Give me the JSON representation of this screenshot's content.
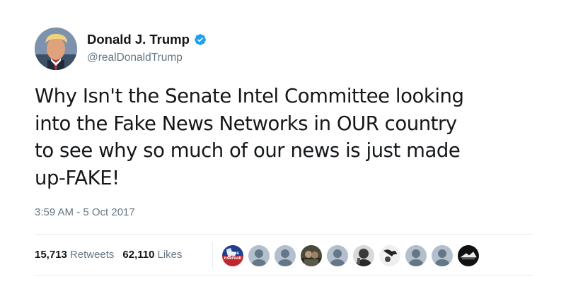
{
  "author": {
    "display_name": "Donald J. Trump",
    "screen_name": "@realDonaldTrump",
    "verified": true,
    "verified_icon": "verified-badge-icon",
    "avatar_icon": "profile-photo"
  },
  "tweet": {
    "text": "Why Isn't the Senate Intel Committee looking\ninto the Fake News Networks in OUR country\nto see why so much of our news is just made\nup-FAKE!",
    "timestamp": "3:59 AM - 5 Oct 2017"
  },
  "stats": {
    "retweets": {
      "count": "15,713",
      "label": "Retweets"
    },
    "likes": {
      "count": "62,110",
      "label": "Likes"
    }
  },
  "likers": [
    {
      "kind": "logo",
      "text_line1": "Texas",
      "text_line2": "nservati"
    },
    {
      "kind": "default-egg"
    },
    {
      "kind": "default-egg"
    },
    {
      "kind": "photo"
    },
    {
      "kind": "default-egg"
    },
    {
      "kind": "photo"
    },
    {
      "kind": "photo"
    },
    {
      "kind": "default-egg"
    },
    {
      "kind": "default-egg"
    },
    {
      "kind": "photo"
    }
  ],
  "colors": {
    "text_primary": "#14171a",
    "text_secondary": "#657786",
    "verified_blue": "#1da1f2",
    "divider": "#e6ecf0",
    "default_avatar_bg": "#b2bfcc",
    "default_avatar_fg": "#657786"
  }
}
